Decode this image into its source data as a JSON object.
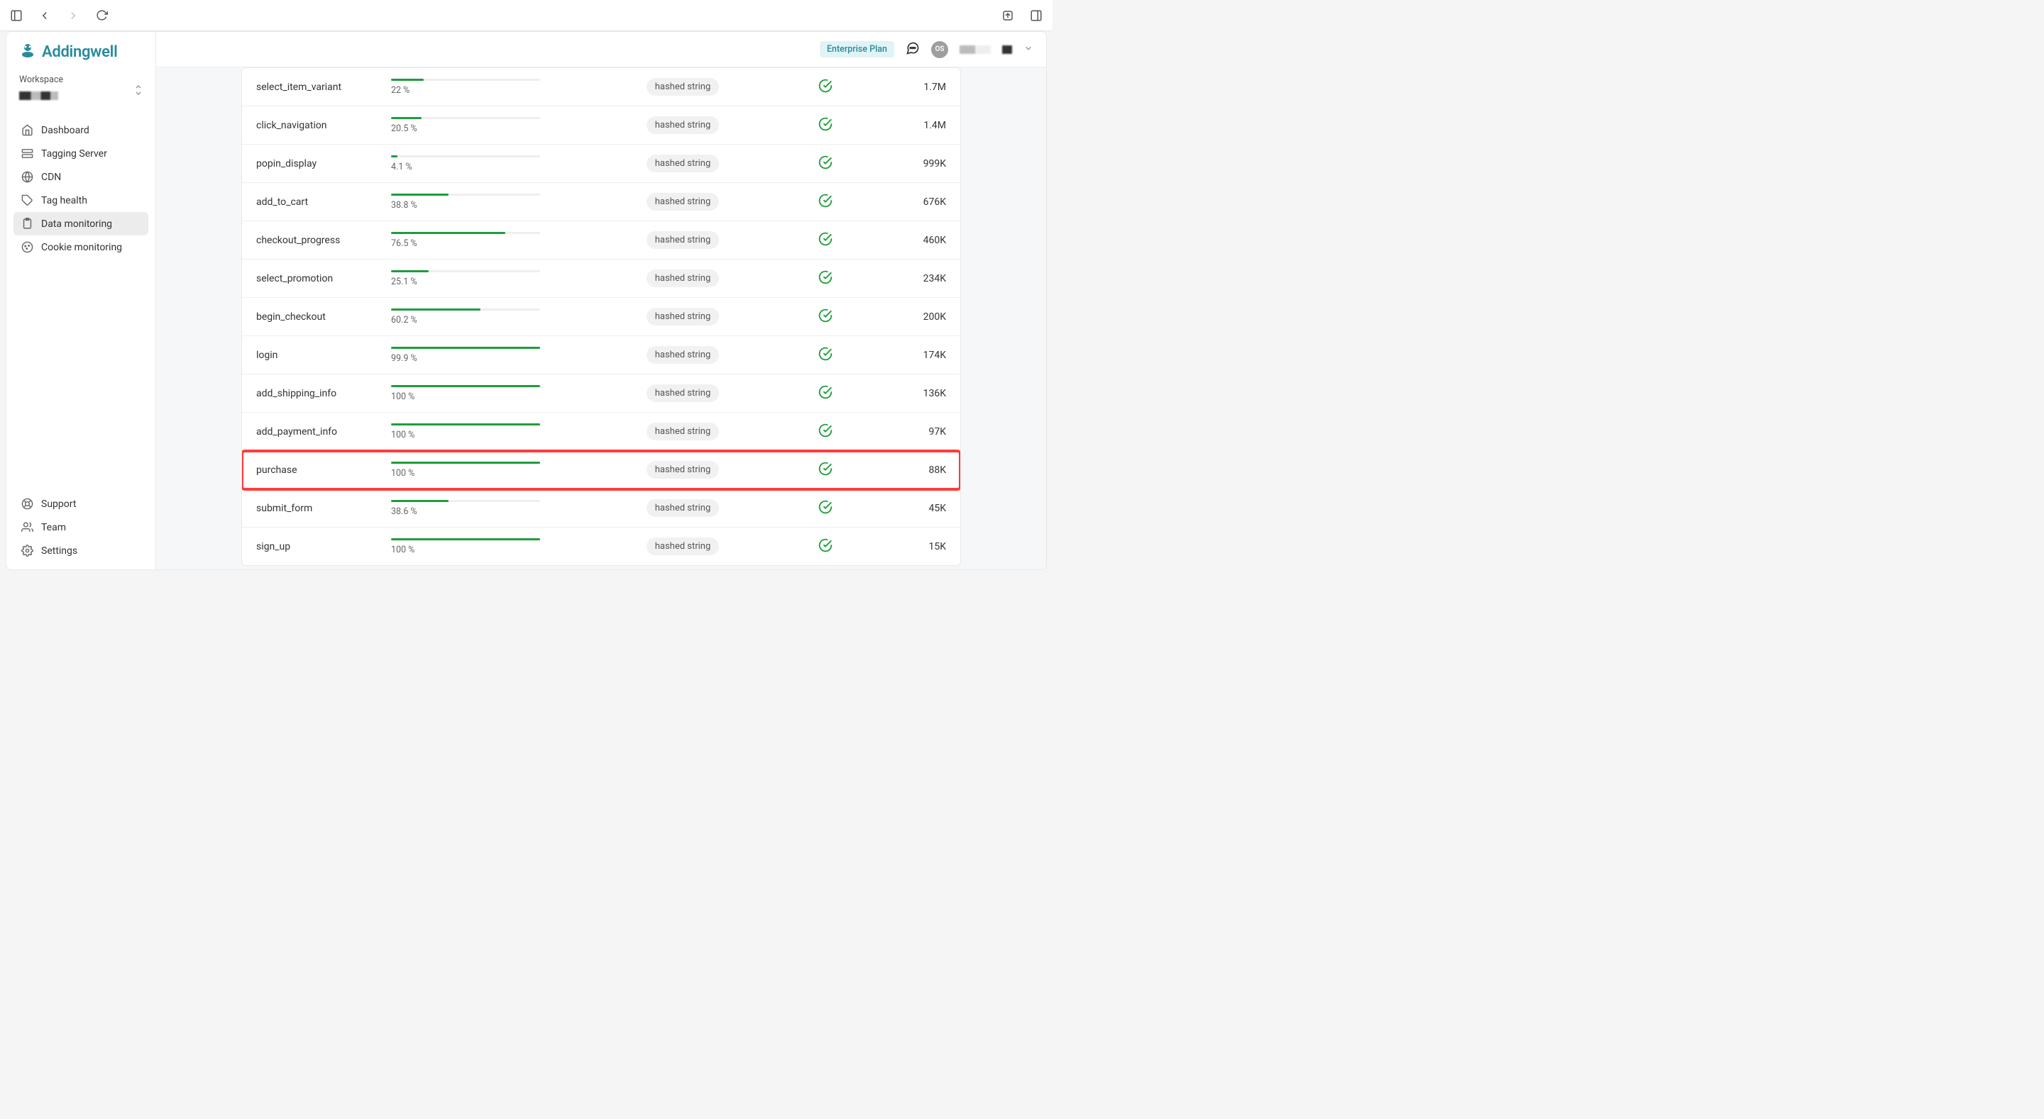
{
  "browser": {},
  "logo_text": "Addingwell",
  "workspace": {
    "label": "Workspace"
  },
  "nav": {
    "items": [
      {
        "key": "dashboard",
        "label": "Dashboard"
      },
      {
        "key": "tagging-server",
        "label": "Tagging Server"
      },
      {
        "key": "cdn",
        "label": "CDN"
      },
      {
        "key": "tag-health",
        "label": "Tag health"
      },
      {
        "key": "data-monitoring",
        "label": "Data monitoring"
      },
      {
        "key": "cookie-monitoring",
        "label": "Cookie monitoring"
      }
    ],
    "bottom": [
      {
        "key": "support",
        "label": "Support"
      },
      {
        "key": "team",
        "label": "Team"
      },
      {
        "key": "settings",
        "label": "Settings"
      }
    ]
  },
  "header": {
    "plan_badge": "Enterprise Plan",
    "avatar_initials": "OS"
  },
  "table": {
    "tag_label": "hashed string",
    "rows": [
      {
        "event": "select_item_variant",
        "pct_label": "22 %",
        "pct": 22,
        "count": "1.7M",
        "highlight": false
      },
      {
        "event": "click_navigation",
        "pct_label": "20.5 %",
        "pct": 20.5,
        "count": "1.4M",
        "highlight": false
      },
      {
        "event": "popin_display",
        "pct_label": "4.1 %",
        "pct": 4.1,
        "count": "999K",
        "highlight": false
      },
      {
        "event": "add_to_cart",
        "pct_label": "38.8 %",
        "pct": 38.8,
        "count": "676K",
        "highlight": false
      },
      {
        "event": "checkout_progress",
        "pct_label": "76.5 %",
        "pct": 76.5,
        "count": "460K",
        "highlight": false
      },
      {
        "event": "select_promotion",
        "pct_label": "25.1 %",
        "pct": 25.1,
        "count": "234K",
        "highlight": false
      },
      {
        "event": "begin_checkout",
        "pct_label": "60.2 %",
        "pct": 60.2,
        "count": "200K",
        "highlight": false
      },
      {
        "event": "login",
        "pct_label": "99.9 %",
        "pct": 99.9,
        "count": "174K",
        "highlight": false
      },
      {
        "event": "add_shipping_info",
        "pct_label": "100 %",
        "pct": 100,
        "count": "136K",
        "highlight": false
      },
      {
        "event": "add_payment_info",
        "pct_label": "100 %",
        "pct": 100,
        "count": "97K",
        "highlight": false
      },
      {
        "event": "purchase",
        "pct_label": "100 %",
        "pct": 100,
        "count": "88K",
        "highlight": true
      },
      {
        "event": "submit_form",
        "pct_label": "38.6 %",
        "pct": 38.6,
        "count": "45K",
        "highlight": false
      },
      {
        "event": "sign_up",
        "pct_label": "100 %",
        "pct": 100,
        "count": "15K",
        "highlight": false
      }
    ]
  }
}
